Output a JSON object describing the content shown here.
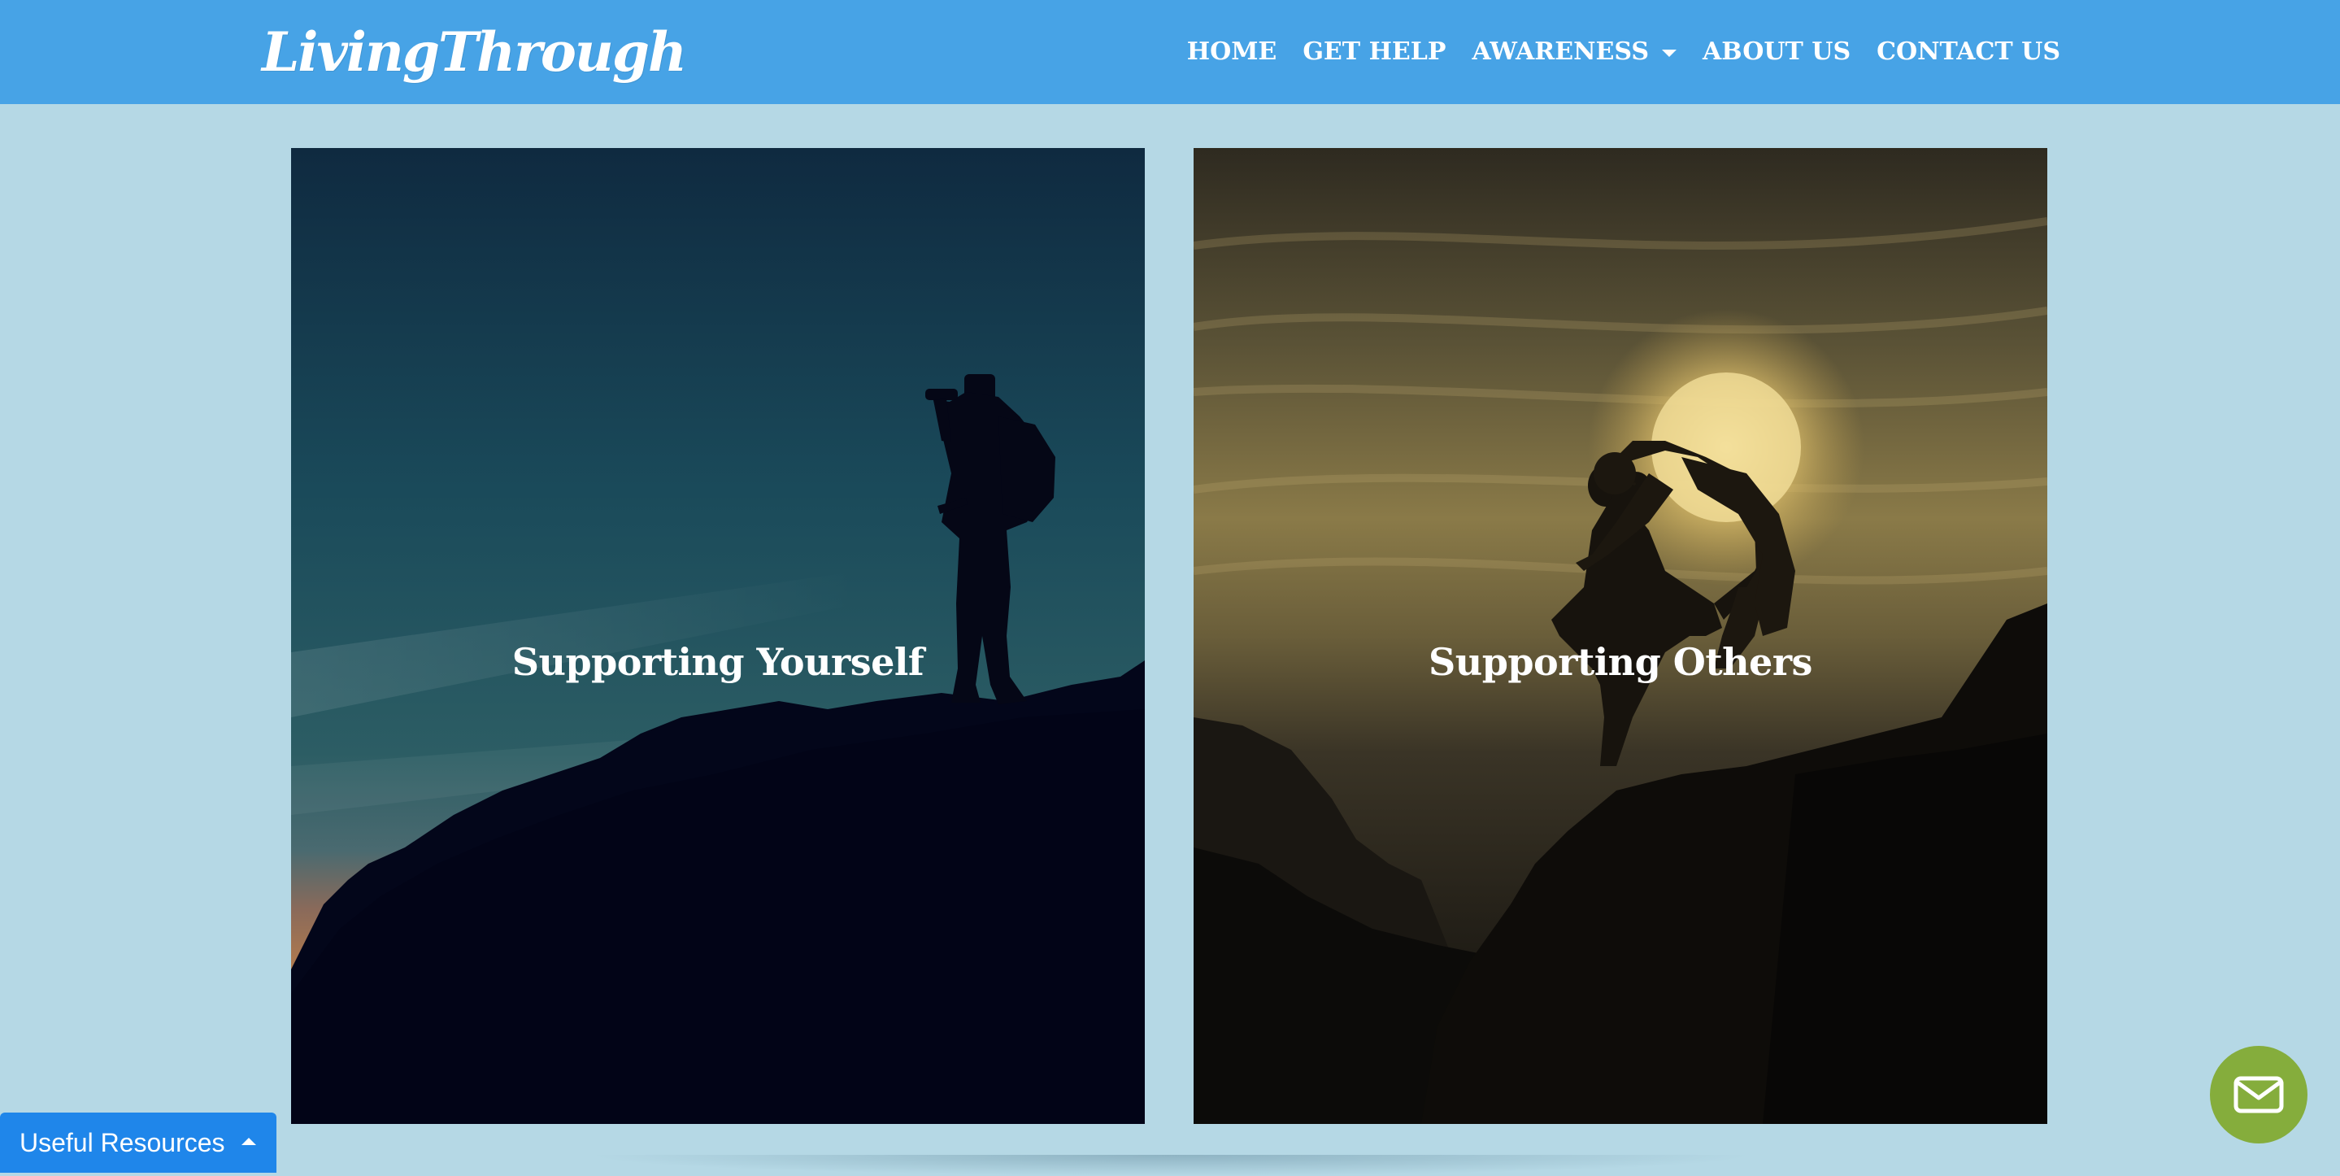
{
  "brand": {
    "logo_text": "LivingThrough"
  },
  "nav": {
    "home": "HOME",
    "get_help": "GET HELP",
    "awareness": "AWARENESS",
    "about_us": "ABOUT US",
    "contact_us": "CONTACT US"
  },
  "cards": [
    {
      "title": "Supporting Yourself"
    },
    {
      "title": "Supporting Others"
    }
  ],
  "footer": {
    "resources_label": "Useful Resources"
  },
  "icons": {
    "awareness_dropdown": "caret-down-icon",
    "resources_toggle": "caret-up-icon",
    "mail": "envelope-icon"
  },
  "colors": {
    "navbar": "#47a3e6",
    "page_background": "#b5d8e5",
    "resources_button": "#1f86ea",
    "mail_button": "#85ad3c"
  }
}
